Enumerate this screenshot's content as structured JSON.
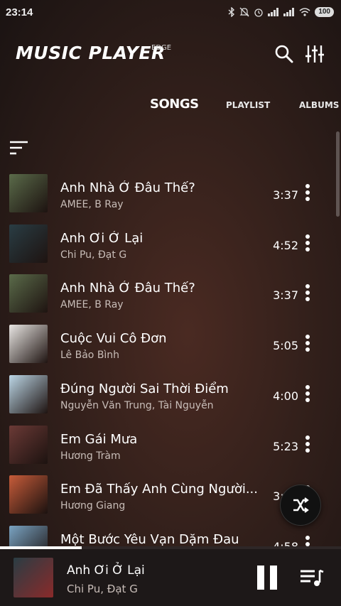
{
  "status_bar": {
    "time": "23:14",
    "battery": "100",
    "icons": [
      "bluetooth-icon",
      "mute-icon",
      "alarm-icon",
      "signal-icon",
      "signal-icon",
      "wifi-icon",
      "battery-icon"
    ]
  },
  "header": {
    "logo": "MUSIC PLAYER",
    "edition": "EDGE",
    "icons": [
      "search-icon",
      "equalizer-icon"
    ]
  },
  "tabs": [
    {
      "label": "SONGS",
      "active": true
    },
    {
      "label": "PLAYLIST",
      "active": false
    },
    {
      "label": "ALBUMS",
      "active": false
    }
  ],
  "songs": [
    {
      "title": "Anh Nhà Ở Đâu Thế?",
      "artist": "AMEE, B Ray",
      "duration": "3:37",
      "art_color": "#5b6b4a"
    },
    {
      "title": "Anh Ơi Ở Lại",
      "artist": "Chi Pu, Đạt G",
      "duration": "4:52",
      "art_color": "#2a3d44"
    },
    {
      "title": "Anh Nhà Ở Đâu Thế?",
      "artist": "AMEE, B Ray",
      "duration": "3:37",
      "art_color": "#5b6b4a"
    },
    {
      "title": "Cuộc Vui Cô Đơn",
      "artist": "Lê Bảo Bình",
      "duration": "5:05",
      "art_color": "#e9e6e3"
    },
    {
      "title": "Đúng Người Sai Thời Điểm",
      "artist": "Nguyễn Văn Trung, Tài Nguyễn",
      "duration": "4:00",
      "art_color": "#bcd6e6"
    },
    {
      "title": "Em Gái Mưa",
      "artist": "Hương Tràm",
      "duration": "5:23",
      "art_color": "#6b3a36"
    },
    {
      "title": "Em Đã Thấy Anh Cùng Người...",
      "artist": "Hương Giang",
      "duration": "3:54",
      "art_color": "#c75c3a"
    },
    {
      "title": "Một Bước Yêu Vạn Dặm Đau",
      "artist": "",
      "duration": "4:58",
      "art_color": "#7aa3c2"
    }
  ],
  "now_playing": {
    "title": "Anh Ơi Ở Lại",
    "artist": "Chi Pu, Đạt G",
    "progress": 0.24,
    "art_color": "#2a3d44"
  },
  "colors": {
    "background": "#33201b",
    "mini_player": "#1d1818",
    "artist_text": "#c8bdb8"
  }
}
